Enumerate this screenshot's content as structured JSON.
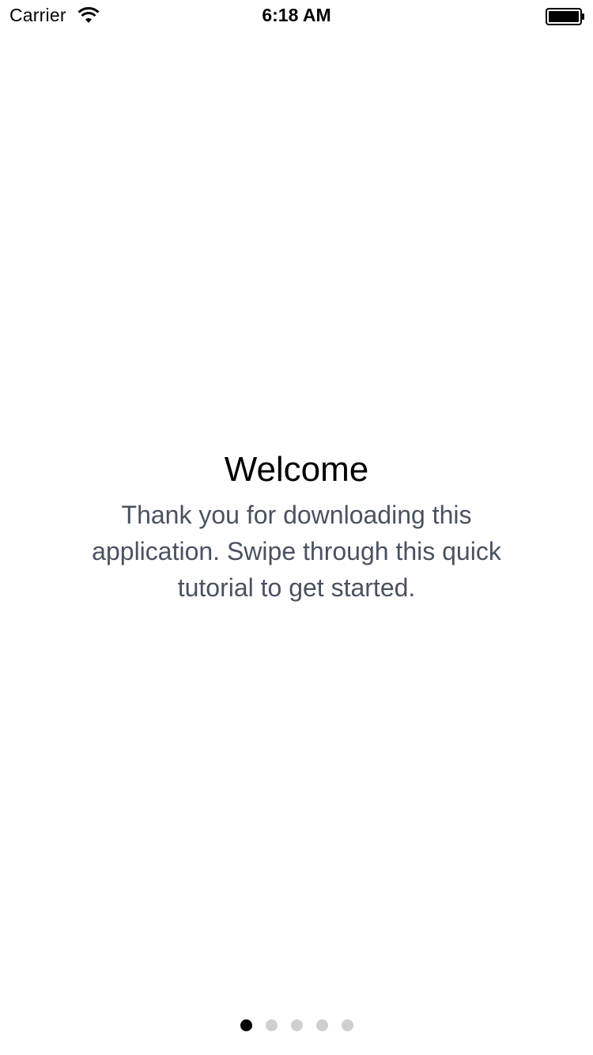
{
  "status_bar": {
    "carrier": "Carrier",
    "time": "6:18 AM",
    "wifi_icon": "wifi-icon",
    "battery_icon": "battery-icon"
  },
  "welcome": {
    "title": "Welcome",
    "body": "Thank you for downloading this application.  Swipe through this quick tutorial to get started."
  },
  "page_control": {
    "total_pages": 5,
    "current_page": 1,
    "active_color": "#000000",
    "inactive_color": "#cfcfcf"
  }
}
